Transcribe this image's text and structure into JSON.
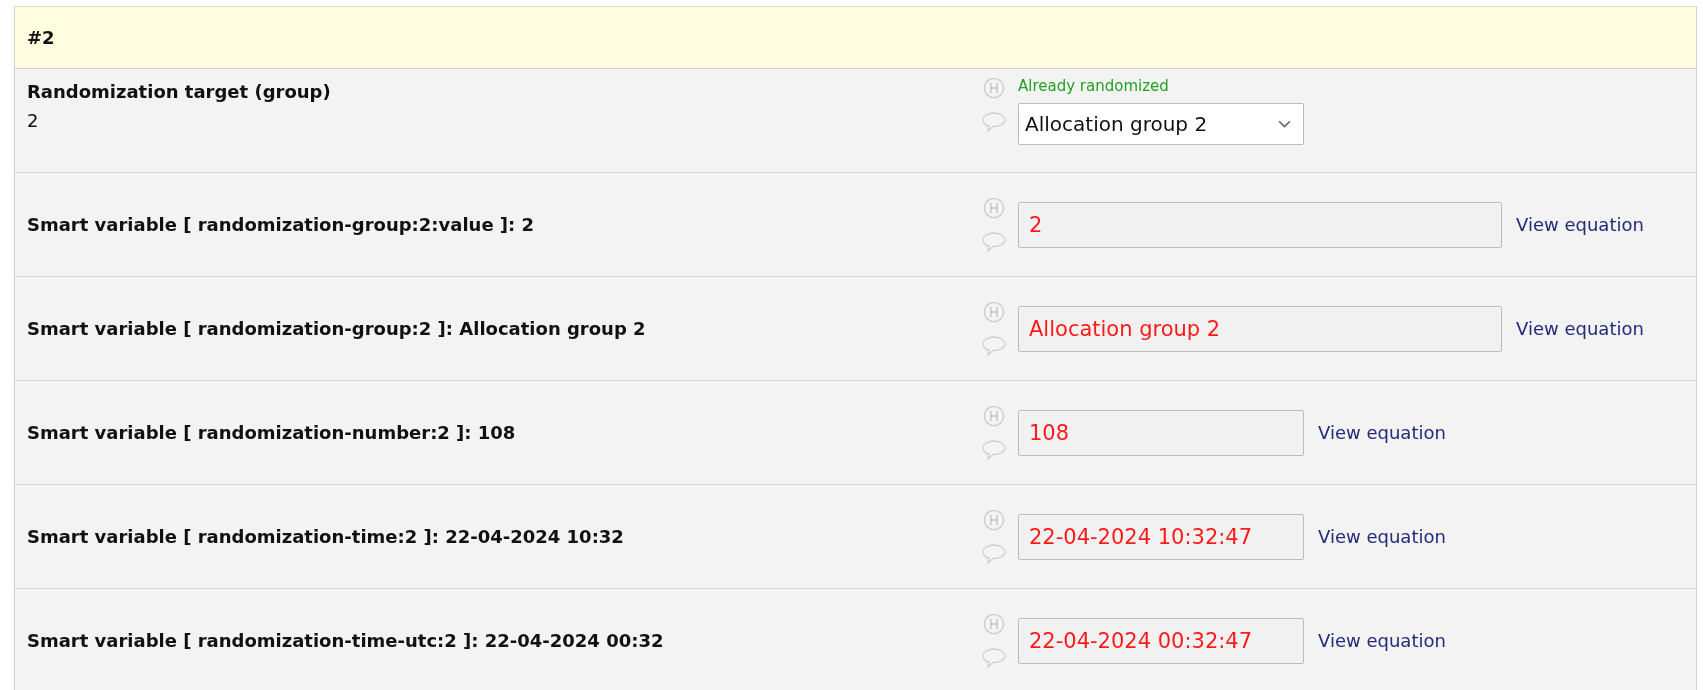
{
  "section": {
    "title": "#2"
  },
  "rows": [
    {
      "label": "Randomization target (group)",
      "value": "2",
      "status": "Already randomized",
      "field": {
        "kind": "select",
        "value": "Allocation group 2"
      }
    },
    {
      "label": "Smart variable [ randomization-group:2:value ]: 2",
      "field": {
        "kind": "wide",
        "value": "2"
      },
      "link": "View equation"
    },
    {
      "label": "Smart variable [ randomization-group:2 ]: Allocation group 2",
      "field": {
        "kind": "wide",
        "value": "Allocation group 2"
      },
      "link": "View equation"
    },
    {
      "label": "Smart variable [ randomization-number:2 ]: 108",
      "field": {
        "kind": "narrow",
        "value": "108"
      },
      "link": "View equation"
    },
    {
      "label": "Smart variable [ randomization-time:2 ]: 22-04-2024 10:32",
      "field": {
        "kind": "narrow",
        "value": "22-04-2024 10:32:47"
      },
      "link": "View equation"
    },
    {
      "label": "Smart variable [ randomization-time-utc:2 ]: 22-04-2024 00:32",
      "field": {
        "kind": "narrow",
        "value": "22-04-2024 00:32:47"
      },
      "link": "View equation"
    }
  ]
}
